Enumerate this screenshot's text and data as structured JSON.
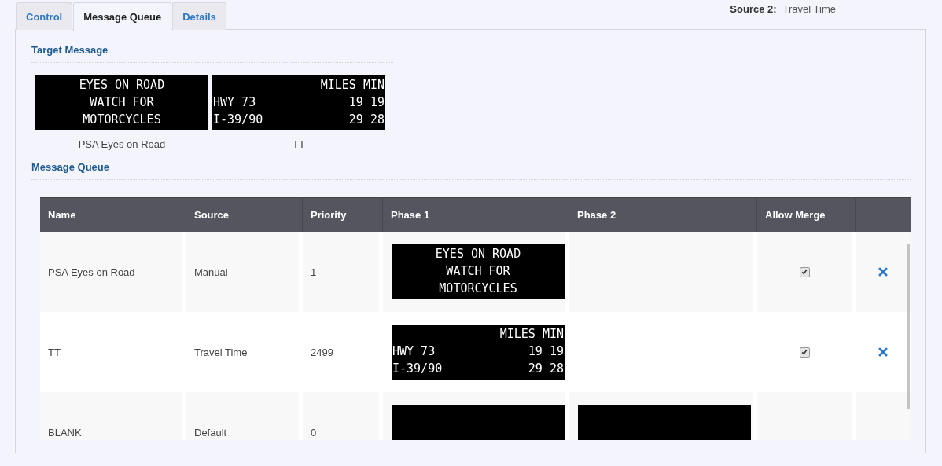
{
  "tabs": [
    {
      "label": "Control",
      "selected": false
    },
    {
      "label": "Message Queue",
      "selected": true
    },
    {
      "label": "Details",
      "selected": false
    }
  ],
  "source_2": {
    "label": "Source 2:",
    "value": "Travel Time"
  },
  "target_message": {
    "heading": "Target Message",
    "signs": [
      {
        "caption": "PSA Eyes on Road",
        "sign": {
          "kind": "text",
          "lines": [
            {
              "center": "EYES ON ROAD"
            },
            {
              "center": "WATCH FOR"
            },
            {
              "center": "MOTORCYCLES"
            }
          ]
        }
      },
      {
        "caption": "TT",
        "sign": {
          "kind": "text",
          "lines": [
            {
              "right": "MILES MIN"
            },
            {
              "left": "HWY 73",
              "right": "19 19"
            },
            {
              "left": "I-39/90",
              "right": "29 28"
            }
          ]
        }
      }
    ]
  },
  "message_queue": {
    "heading": "Message Queue",
    "columns": [
      "Name",
      "Source",
      "Priority",
      "Phase 1",
      "Phase 2",
      "Allow Merge"
    ],
    "rows": [
      {
        "name": "PSA Eyes on Road",
        "source": "Manual",
        "priority": "1",
        "phase_1": {
          "kind": "text",
          "lines": [
            {
              "center": "EYES ON ROAD"
            },
            {
              "center": "WATCH FOR"
            },
            {
              "center": "MOTORCYCLES"
            }
          ]
        },
        "allow_merge": {
          "checked": true
        },
        "deletable": true
      },
      {
        "name": "TT",
        "source": "Travel Time",
        "priority": "2499",
        "phase_1": {
          "kind": "text",
          "lines": [
            {
              "right": "MILES MIN"
            },
            {
              "left": "HWY 73",
              "right": "19 19"
            },
            {
              "left": "I-39/90",
              "right": "29 28"
            }
          ]
        },
        "allow_merge": {
          "checked": true
        },
        "deletable": true
      },
      {
        "name": "BLANK",
        "source": "Default",
        "priority": "0",
        "phase_1": {
          "kind": "blank"
        },
        "phase_2": {
          "kind": "blank"
        },
        "deletable": false
      }
    ]
  }
}
